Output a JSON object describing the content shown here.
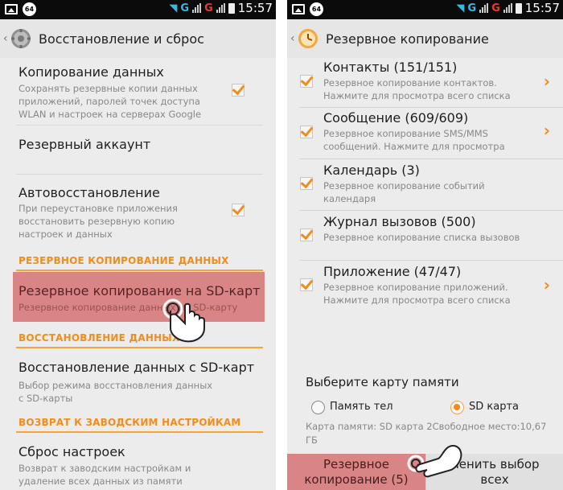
{
  "status": {
    "badge": "64",
    "g1": "G",
    "g2": "G",
    "time": "15:57"
  },
  "left": {
    "title": "Восстановление и сброс",
    "copy": {
      "title": "Копирование данных",
      "desc": "Сохранять резервные копии данных приложений, паролей точек доступа WLAN и настроек на серверах Google",
      "checked": true
    },
    "account": {
      "title": "Резервный аккаунт"
    },
    "autorestore": {
      "title": "Автовосстановление",
      "desc": "При переустановке приложения восстановить резервную копию настроек и данных",
      "checked": true
    },
    "section_backup": "РЕЗЕРВНОЕ КОПИРОВАНИЕ ДАННЫХ",
    "sd_backup": {
      "title": "Резервное копирование на SD-карт",
      "desc": "Резервное копирование данных на SD-карту"
    },
    "section_restore": "ВОССТАНОВЛЕНИЕ ДАННЫХ",
    "sd_restore": {
      "title": "Восстановление данных с SD-карт",
      "desc": "Выбор режима восстановления данных с SD-карты"
    },
    "section_reset": "ВОЗВРАТ К ЗАВОДСКИМ НАСТРОЙКАМ",
    "reset": {
      "title": "Сброс настроек",
      "desc": "Возврат к заводским настройкам и удаление всех данных из памяти телефона"
    }
  },
  "right": {
    "title": "Резервное копирование",
    "items": [
      {
        "title": "Контакты (151/151)",
        "desc": "Резервное копирование контактов. Нажмите для просмотра всего списка",
        "checked": true,
        "chevron": true
      },
      {
        "title": "Сообщение (609/609)",
        "desc": "Резервное копирование SMS/MMS сообщений. Нажмите для просмотра",
        "checked": true,
        "chevron": true
      },
      {
        "title": "Календарь (3)",
        "desc": "Резервное копирование событий календаря",
        "checked": true,
        "chevron": false
      },
      {
        "title": "Журнал вызовов (500)",
        "desc": "Резервное копирование списка вызовов",
        "checked": true,
        "chevron": false
      },
      {
        "title": "Приложение (47/47)",
        "desc": "Резервное копирование приложений. Нажмите для просмотра всего списка",
        "checked": true,
        "chevron": true
      }
    ],
    "memory": {
      "title": "Выберите карту памяти",
      "option_phone": "Память тел",
      "option_sd": "SD карта",
      "selected": "SD карта",
      "info": "Карта памяти: SD карта 2Свободное место:10,67 ГБ"
    },
    "buttons": {
      "backup_line1": "Резервное",
      "backup_line2": "копирование (5)",
      "change_line1": "менить выбор",
      "change_line2": "всех"
    }
  },
  "colors": {
    "accent": "#f28c1a",
    "highlight": "#d98585"
  }
}
